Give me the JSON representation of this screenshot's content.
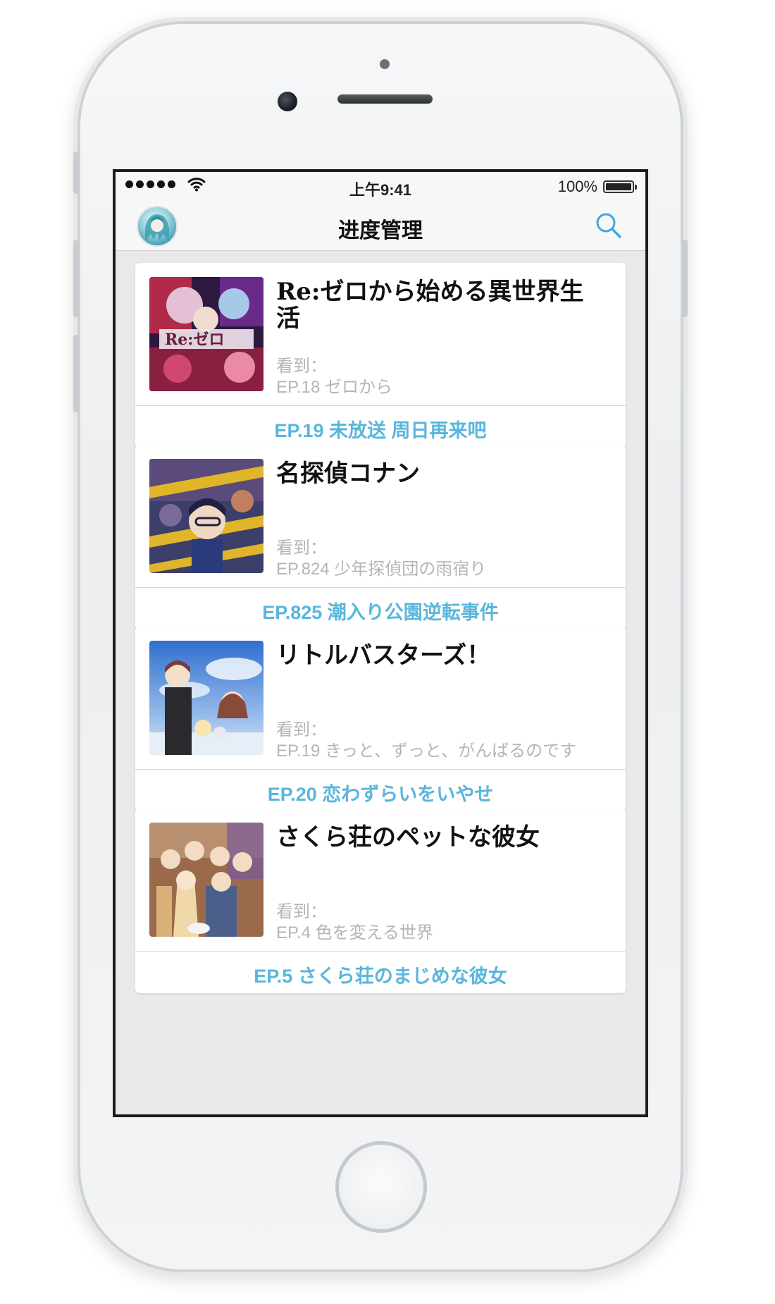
{
  "status_bar": {
    "time": "上午9:41",
    "battery": "100%"
  },
  "nav": {
    "title": "进度管理",
    "avatar": "avatar",
    "search_icon": "search-icon"
  },
  "cards": [
    {
      "title": "Re:ゼロから始める異世界生活",
      "watched_label": "看到：",
      "watched_ep": "EP.18 ゼロから",
      "next_ep": "EP.19 未放送 周日再来吧",
      "cover_colors": [
        "#b22a4a",
        "#6a2a8a",
        "#e3c0d4",
        "#2b1940"
      ],
      "cover_text": "Re:ゼロ"
    },
    {
      "title": "名探偵コナン",
      "watched_label": "看到：",
      "watched_ep": "EP.824 少年探偵団の雨宿り",
      "next_ep": "EP.825 潮入り公園逆転事件",
      "cover_colors": [
        "#3b3f6a",
        "#e0b52a",
        "#5a4b7a",
        "#1e2142"
      ]
    },
    {
      "title": "リトルバスターズ！",
      "watched_label": "看到：",
      "watched_ep": "EP.19 きっと、ずっと、がんばるのです",
      "next_ep": "EP.20 恋わずらいをいやせ",
      "cover_colors": [
        "#3f7fd8",
        "#cfe3f7",
        "#7a3a3a",
        "#f2e0c8"
      ]
    },
    {
      "title": "さくら荘のペットな彼女",
      "watched_label": "看到：",
      "watched_ep": "EP.4 色を変える世界",
      "next_ep": "EP.5 さくら荘のまじめな彼女",
      "cover_colors": [
        "#9a6a4a",
        "#f0d8a8",
        "#4a5f8a",
        "#d8b078"
      ]
    }
  ],
  "colors": {
    "accent": "#59b6dc",
    "divider": "#f2c9cd",
    "muted_text": "#b5b5b7",
    "screen_bg": "#e9e9ea"
  }
}
